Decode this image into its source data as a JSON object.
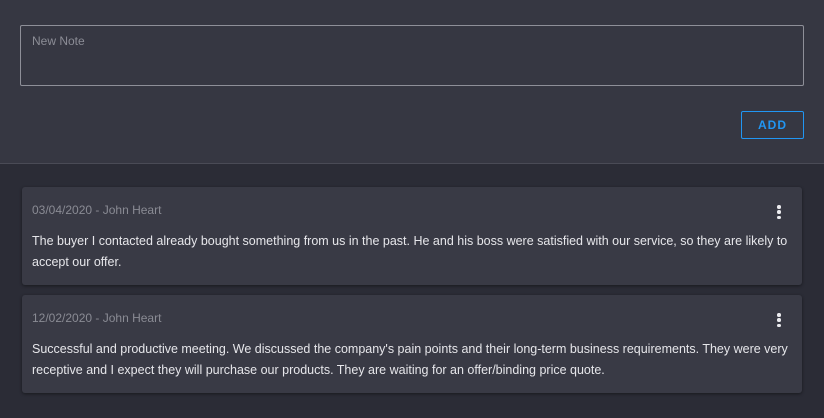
{
  "new_note": {
    "placeholder": "New Note",
    "add_label": "ADD"
  },
  "notes": [
    {
      "meta": "03/04/2020 - John Heart",
      "text": "The buyer I contacted already bought something from us in the past. He and his boss were satisfied with our service, so they are likely to accept our offer."
    },
    {
      "meta": "12/02/2020 - John Heart",
      "text": "Successful and productive meeting. We discussed the company's pain points and their long-term business requirements. They were very receptive and I expect they will purchase our products. They are waiting for an offer/binding price quote."
    }
  ],
  "icons": {
    "more": "more-vert-icon"
  },
  "colors": {
    "accent": "#2196f3",
    "background": "#2b2c36",
    "card": "#393a45"
  }
}
